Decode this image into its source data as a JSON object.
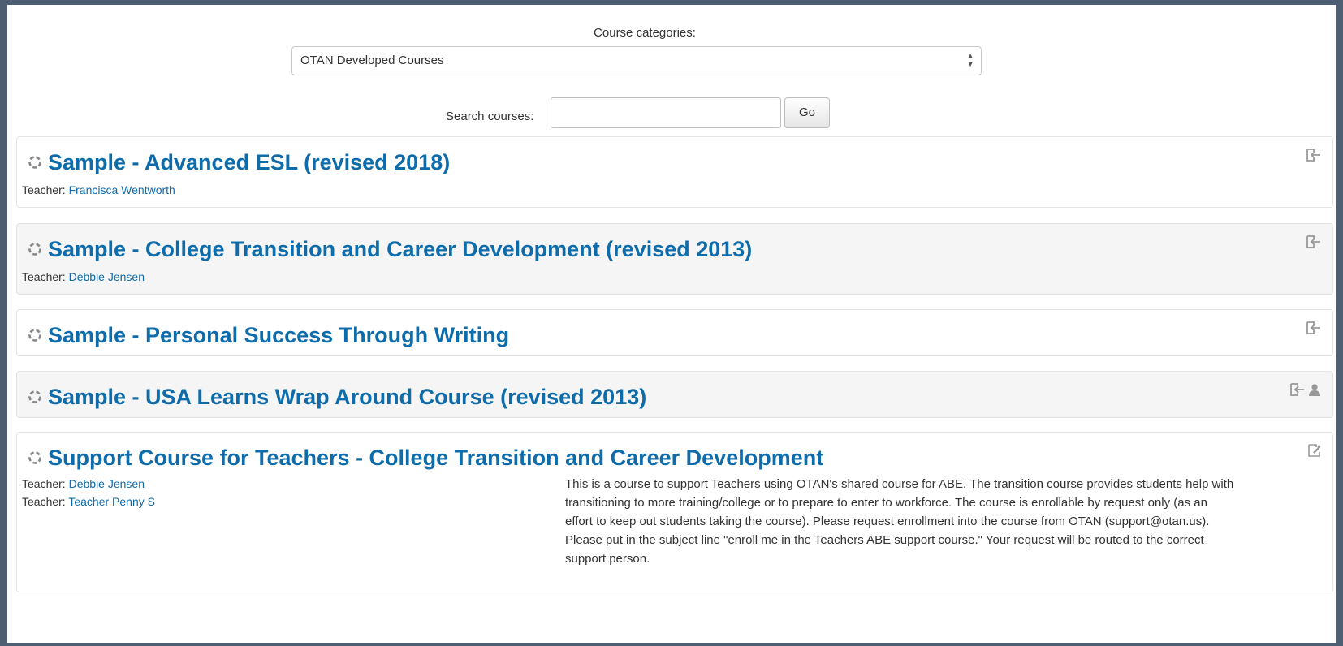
{
  "categories": {
    "label": "Course categories:",
    "selected": "OTAN Developed Courses"
  },
  "search": {
    "label": "Search courses:",
    "value": "",
    "go_label": "Go"
  },
  "colors": {
    "link": "#0f6cab",
    "frame": "#4f5f73",
    "alt_row": "#f5f5f5"
  },
  "courses": [
    {
      "title": "Sample - Advanced ESL (revised 2018)",
      "teachers": [
        {
          "label": "Teacher:",
          "name": "Francisca Wentworth"
        }
      ],
      "icons": [
        "self-enrol-icon"
      ]
    },
    {
      "title": "Sample - College Transition and Career Development (revised 2013)",
      "teachers": [
        {
          "label": "Teacher:",
          "name": "Debbie Jensen"
        }
      ],
      "icons": [
        "self-enrol-icon"
      ]
    },
    {
      "title": "Sample - Personal Success Through Writing",
      "teachers": [],
      "icons": [
        "self-enrol-icon"
      ]
    },
    {
      "title": "Sample - USA Learns Wrap Around Course (revised 2013)",
      "teachers": [],
      "icons": [
        "self-enrol-icon",
        "guest-access-icon"
      ]
    },
    {
      "title": "Support Course for Teachers - College Transition and Career Development",
      "teachers": [
        {
          "label": "Teacher:",
          "name": "Debbie Jensen"
        },
        {
          "label": "Teacher:",
          "name": "Teacher Penny S"
        }
      ],
      "icons": [
        "enrolment-key-icon"
      ],
      "summary": "This is a course to support Teachers using OTAN's shared course for ABE. The transition course provides students help with transitioning to more training/college or to prepare to enter to workforce. The course is enrollable by request only (as an effort to keep out students taking the course). Please request enrollment into the course from OTAN (support@otan.us). Please put in the subject line \"enroll me in the Teachers ABE support course.\" Your request will be routed to the correct support person."
    }
  ]
}
